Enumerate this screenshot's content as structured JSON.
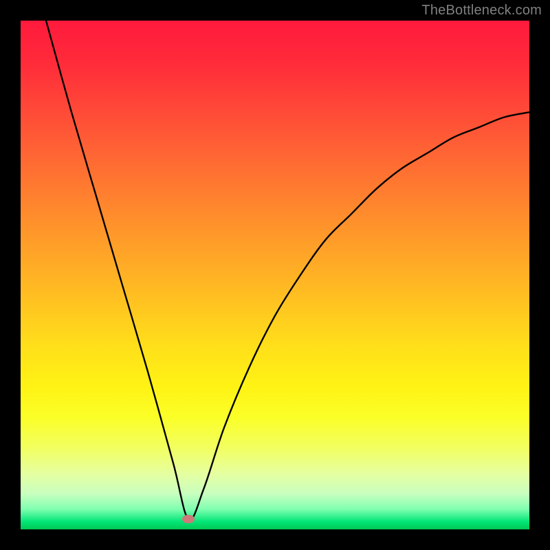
{
  "watermark": "TheBottleneck.com",
  "chart_data": {
    "type": "line",
    "title": "",
    "xlabel": "",
    "ylabel": "",
    "xlim": [
      0,
      100
    ],
    "ylim": [
      0,
      100
    ],
    "grid": false,
    "legend": false,
    "background": "vertical rainbow gradient (top red → yellow → green bottom)",
    "marker": {
      "x": 33,
      "y": 2
    },
    "series": [
      {
        "name": "bottleneck-curve",
        "x": [
          5,
          10,
          15,
          20,
          25,
          30,
          33,
          36,
          40,
          45,
          50,
          55,
          60,
          65,
          70,
          75,
          80,
          85,
          90,
          95,
          100
        ],
        "values": [
          100,
          82,
          65,
          48,
          31,
          13,
          2,
          8,
          20,
          32,
          42,
          50,
          57,
          62,
          67,
          71,
          74,
          77,
          79,
          81,
          82
        ]
      }
    ],
    "gradient_stops": [
      {
        "pos": 0.0,
        "color": "#ff1a3c"
      },
      {
        "pos": 0.5,
        "color": "#ffc520"
      },
      {
        "pos": 0.82,
        "color": "#fbff28"
      },
      {
        "pos": 0.96,
        "color": "#80ffb0"
      },
      {
        "pos": 1.0,
        "color": "#00c853"
      }
    ]
  }
}
